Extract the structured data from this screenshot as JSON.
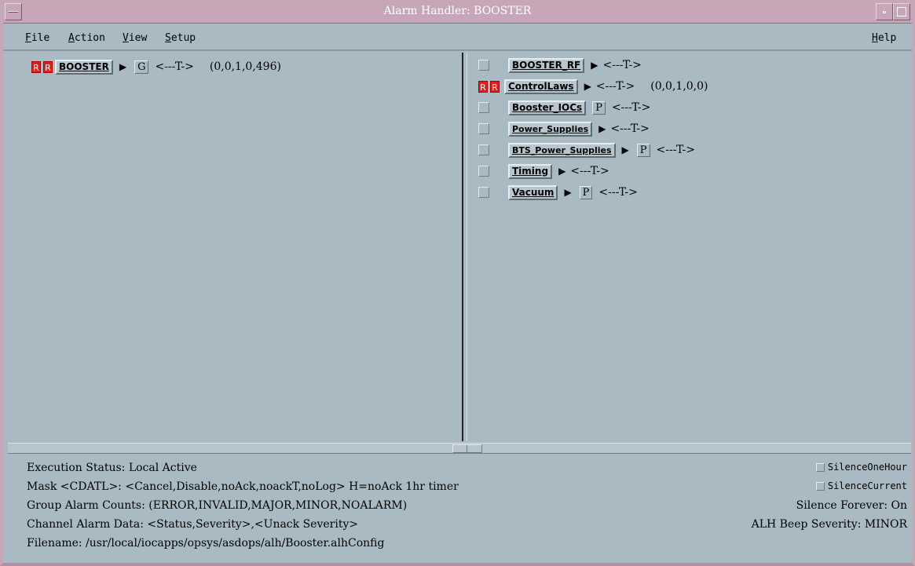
{
  "window": {
    "title": "Alarm Handler: BOOSTER"
  },
  "menu": {
    "file": {
      "ul": "F",
      "rest": "ile"
    },
    "action": {
      "ul": "A",
      "rest": "ction"
    },
    "view": {
      "ul": "V",
      "rest": "iew"
    },
    "setup": {
      "ul": "S",
      "rest": "etup"
    },
    "help": {
      "ul": "H",
      "rest": "elp"
    }
  },
  "left_tree": {
    "r1": "R",
    "r2": "R",
    "group_name": "BOOSTER",
    "arrow": "▶",
    "flag": "G",
    "tstr": "<---T->",
    "counts": "(0,0,1,0,496)"
  },
  "right_tree": [
    {
      "name": "BOOSTER_RF",
      "alarm": false,
      "arrow": "▶",
      "flag": "",
      "tstr": "<---T->",
      "counts": ""
    },
    {
      "name": "ControlLaws",
      "alarm": true,
      "r1": "R",
      "r2": "R",
      "arrow": "▶",
      "flag": "",
      "tstr": "<---T->",
      "counts": "(0,0,1,0,0)"
    },
    {
      "name": "Booster_IOCs",
      "alarm": false,
      "arrow": "",
      "flag": "P",
      "tstr": "<---T->",
      "counts": ""
    },
    {
      "name": "Power_Supplies",
      "alarm": false,
      "arrow": "▶",
      "flag": "",
      "tstr": "<---T->",
      "counts": ""
    },
    {
      "name": "BTS_Power_Supplies",
      "alarm": false,
      "arrow": "▶",
      "flag": "P",
      "tstr": "<---T->",
      "counts": ""
    },
    {
      "name": "Timing",
      "alarm": false,
      "arrow": "▶",
      "flag": "",
      "tstr": "<---T->",
      "counts": ""
    },
    {
      "name": "Vacuum",
      "alarm": false,
      "arrow": "▶",
      "flag": "P",
      "tstr": "<---T->",
      "counts": ""
    }
  ],
  "status": {
    "execution": "Execution Status:  Local Active",
    "mask": "Mask <CDATL>:  <Cancel,Disable,noAck,noackT,noLog>     H=noAck 1hr timer",
    "group_counts": "Group Alarm Counts:  (ERROR,INVALID,MAJOR,MINOR,NOALARM)",
    "channel_data": "Channel Alarm Data:  <Status,Severity>,<Unack Severity>",
    "filename": "Filename:   /usr/local/iocapps/opsys/asdops/alh/Booster.alhConfig",
    "silence_one_hour": "SilenceOneHour",
    "silence_current": "SilenceCurrent",
    "silence_forever": "Silence Forever:   On",
    "beep_severity": "ALH Beep Severity:  MINOR"
  },
  "colors": {
    "background": "#a9bac2",
    "title_bar": "#c7a6b7",
    "alarm_red": "#e61b1b"
  }
}
